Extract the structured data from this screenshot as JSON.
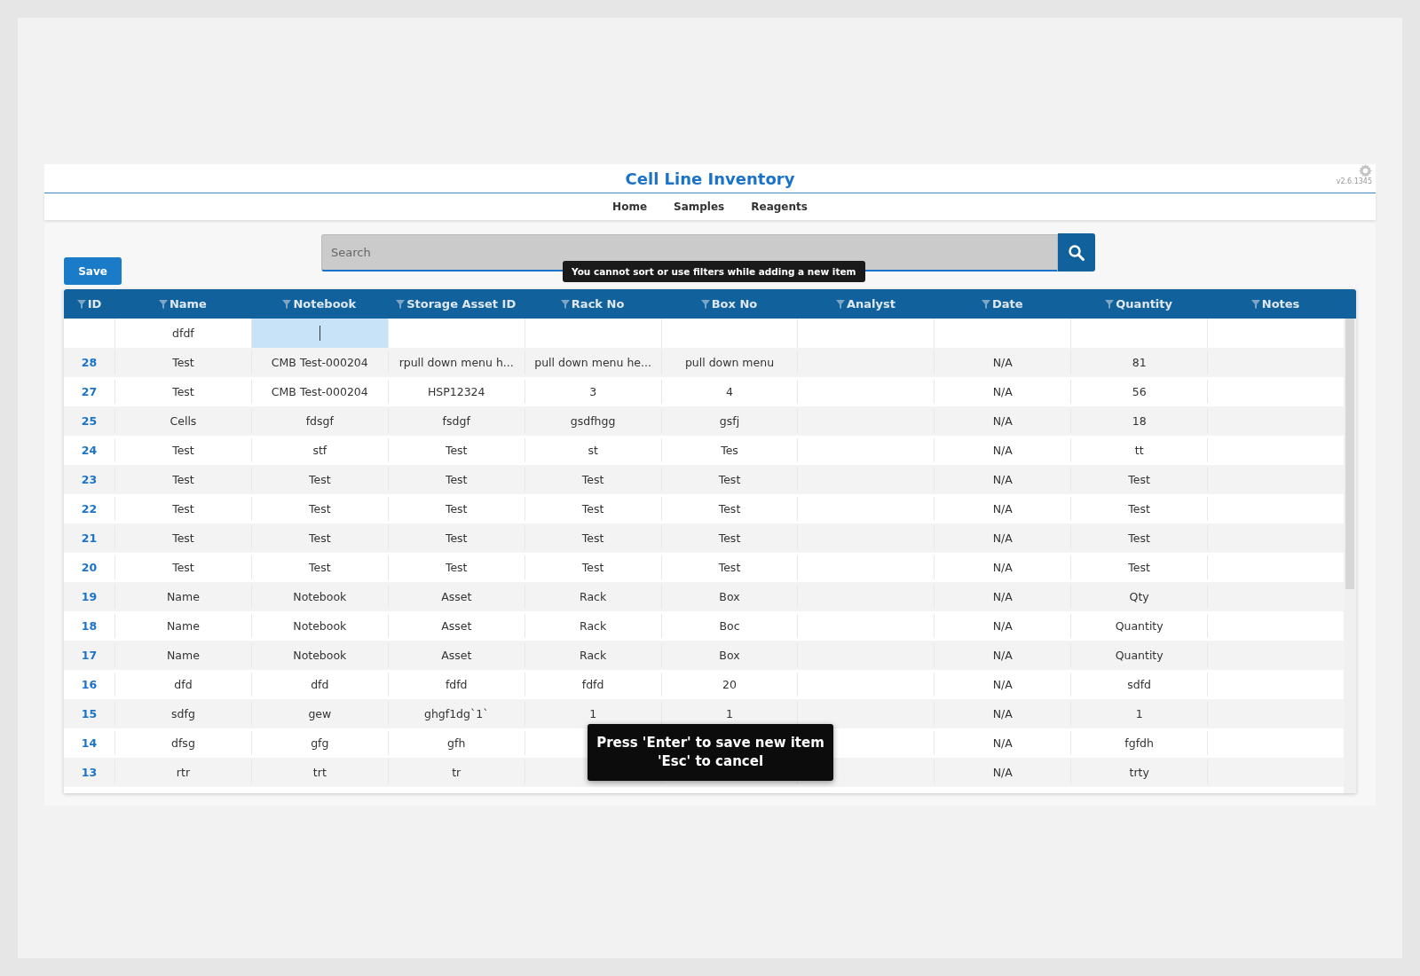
{
  "header": {
    "title": "Cell Line Inventory",
    "version": "v2.6.1345"
  },
  "nav": [
    {
      "label": "Home"
    },
    {
      "label": "Samples"
    },
    {
      "label": "Reagents"
    }
  ],
  "search": {
    "placeholder": "Search"
  },
  "save_button": "Save",
  "filter_tooltip": "You cannot sort or use filters while adding a new item",
  "table": {
    "columns": [
      "ID",
      "Name",
      "Notebook",
      "Storage Asset ID",
      "Rack No",
      "Box No",
      "Analyst",
      "Date",
      "Quantity",
      "Notes"
    ],
    "new_row": [
      {
        "kind": "empty"
      },
      {
        "kind": "text",
        "value": "dfdf"
      },
      {
        "kind": "editor"
      },
      {
        "kind": "empty"
      },
      {
        "kind": "empty"
      },
      {
        "kind": "empty"
      },
      {
        "kind": "empty"
      },
      {
        "kind": "empty"
      },
      {
        "kind": "empty"
      },
      {
        "kind": "empty"
      }
    ],
    "rows": [
      [
        "28",
        "Test",
        "CMB Test-000204",
        "rpull down menu h...",
        "pull down menu he...",
        "pull down menu",
        null,
        "N/A",
        "81",
        null
      ],
      [
        "27",
        "Test",
        "CMB Test-000204",
        "HSP12324",
        "3",
        "4",
        null,
        "N/A",
        "56",
        null
      ],
      [
        "25",
        "Cells",
        "fdsgf",
        "fsdgf",
        "gsdfhgg",
        "gsfj",
        null,
        "N/A",
        "18",
        null
      ],
      [
        "24",
        "Test",
        "stf",
        "Test",
        "st",
        "Tes",
        null,
        "N/A",
        "tt",
        null
      ],
      [
        "23",
        "Test",
        "Test",
        "Test",
        "Test",
        "Test",
        null,
        "N/A",
        "Test",
        null
      ],
      [
        "22",
        "Test",
        "Test",
        "Test",
        "Test",
        "Test",
        null,
        "N/A",
        "Test",
        null
      ],
      [
        "21",
        "Test",
        "Test",
        "Test",
        "Test",
        "Test",
        null,
        "N/A",
        "Test",
        null
      ],
      [
        "20",
        "Test",
        "Test",
        "Test",
        "Test",
        "Test",
        null,
        "N/A",
        "Test",
        null
      ],
      [
        "19",
        "Name",
        "Notebook",
        "Asset",
        "Rack",
        "Box",
        null,
        "N/A",
        "Qty",
        null
      ],
      [
        "18",
        "Name",
        "Notebook",
        "Asset",
        "Rack",
        "Boc",
        null,
        "N/A",
        "Quantity",
        null
      ],
      [
        "17",
        "Name",
        "Notebook",
        "Asset",
        "Rack",
        "Box",
        null,
        "N/A",
        "Quantity",
        null
      ],
      [
        "16",
        "dfd",
        "dfd",
        "fdfd",
        "fdfd",
        "20",
        null,
        "N/A",
        "sdfd",
        null
      ],
      [
        "15",
        "sdfg",
        "gew",
        "ghgf1dg`1`",
        "1",
        "1",
        null,
        "N/A",
        "1",
        null
      ],
      [
        "14",
        "dfsg",
        "gfg",
        "gfh",
        null,
        null,
        null,
        "N/A",
        "fgfdh",
        null
      ],
      [
        "13",
        "rtr",
        "trt",
        "tr",
        null,
        null,
        null,
        "N/A",
        "trty",
        null
      ]
    ]
  },
  "save_tooltip": [
    "Press 'Enter' to save new item",
    "'Esc' to cancel"
  ]
}
